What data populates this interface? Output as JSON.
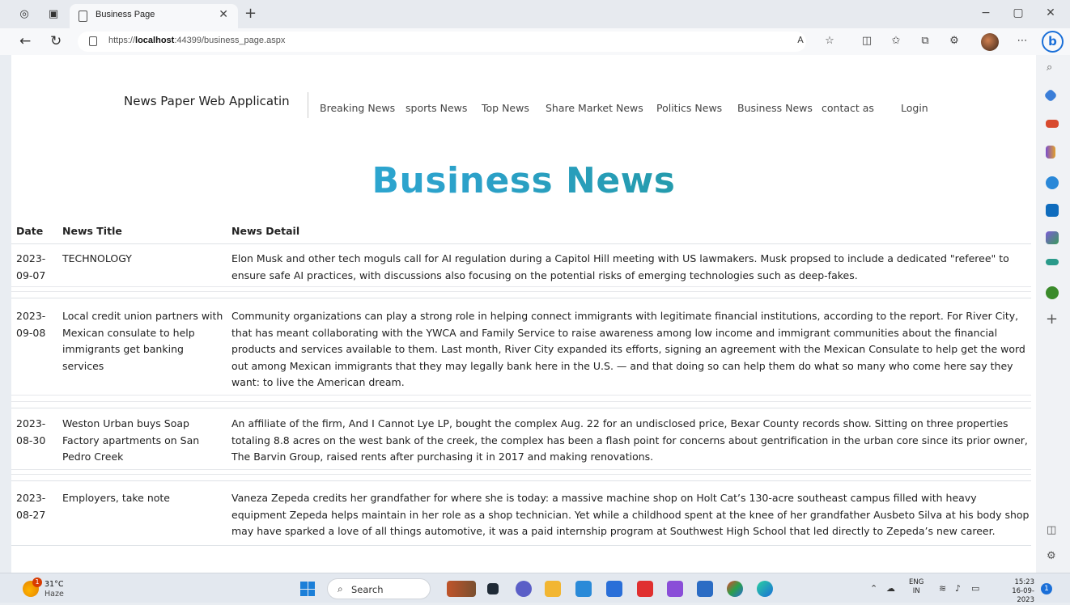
{
  "browser": {
    "tab_title": "Business Page",
    "url_prefix": "https://",
    "url_host": "localhost",
    "url_rest": ":44399/business_page.aspx"
  },
  "site": {
    "brand": "News Paper Web Applicatin",
    "nav": [
      "Breaking News",
      "sports News",
      "Top News",
      "Share Market News",
      "Politics News",
      "Business News",
      "contact as",
      "Login"
    ],
    "heading": "Business News"
  },
  "table": {
    "headers": [
      "Date",
      "News Title",
      "News Detail"
    ],
    "rows": [
      {
        "date": "2023-09-07",
        "title": "TECHNOLOGY",
        "detail": "Elon Musk and other tech moguls call for AI regulation during a Capitol Hill meeting with US lawmakers. Musk propsed to include a dedicated \"referee\" to ensure safe AI practices, with discussions also focusing on the potential risks of emerging technologies such as deep-fakes."
      },
      {
        "date": "2023-09-08",
        "title": "Local credit union partners with Mexican consulate to help immigrants get banking services",
        "detail": "Community organizations can play a strong role in helping connect immigrants with legitimate financial institutions, according to the report. For River City, that has meant collaborating with the YWCA and Family Service to raise awareness among low income and immigrant communities about the financial products and services available to them. Last month, River City expanded its efforts, signing an agreement with the Mexican Consulate to help get the word out among Mexican immigrants that they may legally bank here in the U.S. — and that doing so can help them do what so many who come here say they want: to live the American dream."
      },
      {
        "date": "2023-08-30",
        "title": "Weston Urban buys Soap Factory apartments on San Pedro Creek",
        "detail": "An affiliate of the firm, And I Cannot Lye LP, bought the complex Aug. 22 for an undisclosed price, Bexar County records show. Sitting on three properties totaling 8.8 acres on the west bank of the creek, the complex has been a flash point for concerns about gentrification in the urban core since its prior owner, The Barvin Group, raised rents after purchasing it in 2017 and making renovations."
      },
      {
        "date": "2023-08-27",
        "title": "Employers, take note",
        "detail": "Vaneza Zepeda credits her grandfather for where she is today: a massive machine shop on Holt Cat’s 130-acre southeast campus filled with heavy equipment Zepeda helps maintain in her role as a shop technician. Yet while a childhood spent at the knee of her grandfather Ausbeto Silva at his body shop may have sparked a love of all things automotive, it was a paid internship program at Southwest High School that led directly to Zepeda’s new career."
      }
    ]
  },
  "taskbar": {
    "weather_badge": "1",
    "temperature": "31°C",
    "condition": "Haze",
    "search_label": "Search",
    "lang_top": "ENG",
    "lang_bottom": "IN",
    "time": "15:23",
    "date": "16-09-2023",
    "notification_count": "1"
  }
}
